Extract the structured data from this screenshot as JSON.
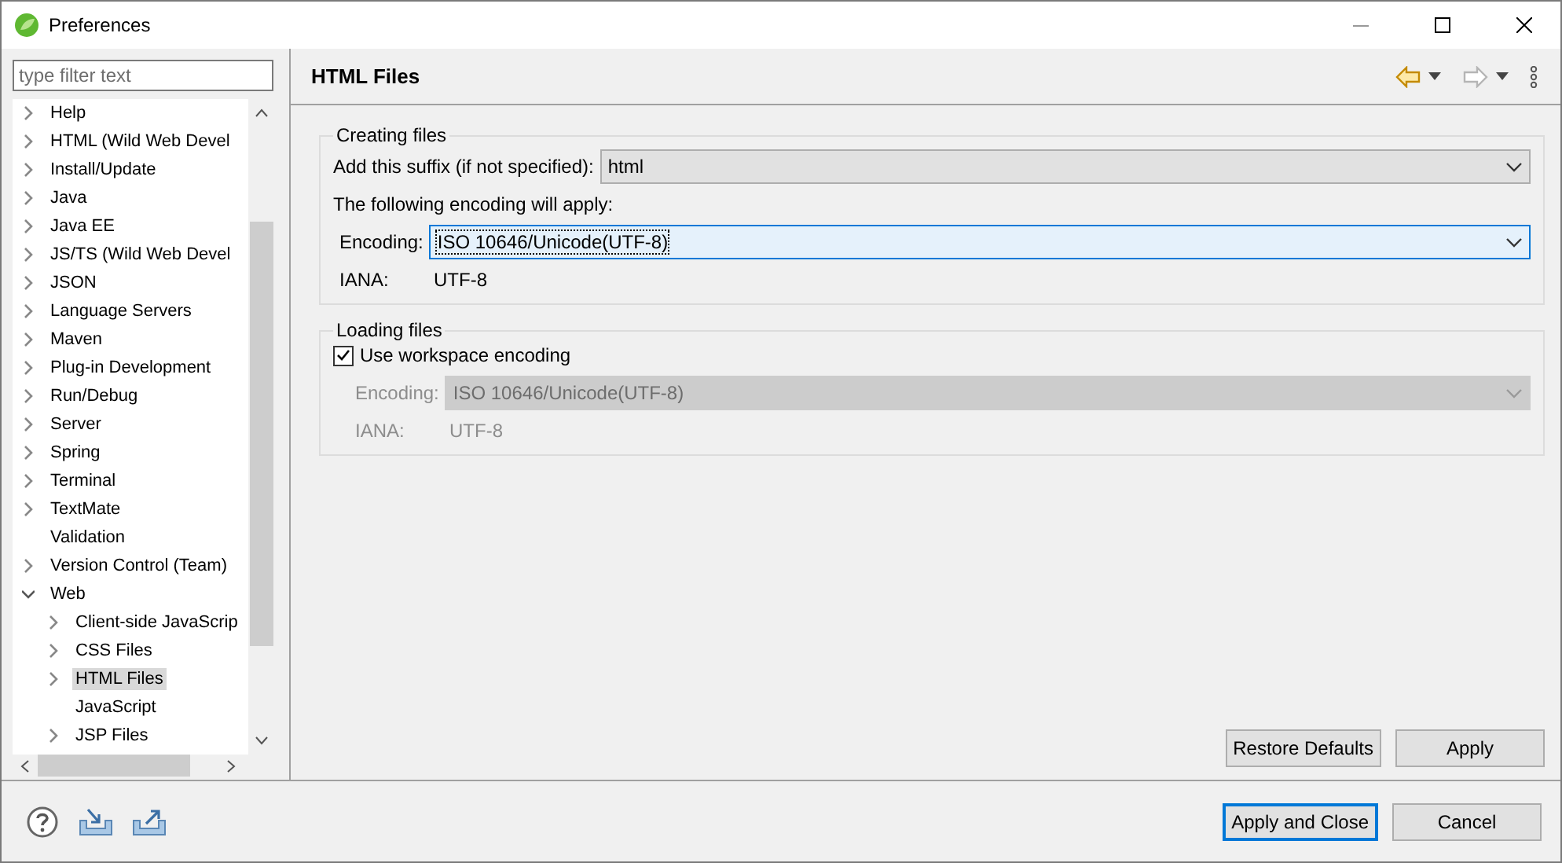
{
  "window": {
    "title": "Preferences"
  },
  "sidebar": {
    "filter": {
      "placeholder": "type filter text"
    },
    "tree": [
      {
        "label": "Help",
        "kind": "folder",
        "expanded": false,
        "selected": false
      },
      {
        "label": "HTML (Wild Web Devel",
        "kind": "folder",
        "expanded": false,
        "selected": false
      },
      {
        "label": "Install/Update",
        "kind": "folder",
        "expanded": false,
        "selected": false
      },
      {
        "label": "Java",
        "kind": "folder",
        "expanded": false,
        "selected": false
      },
      {
        "label": "Java EE",
        "kind": "folder",
        "expanded": false,
        "selected": false
      },
      {
        "label": "JS/TS (Wild Web Devel",
        "kind": "folder",
        "expanded": false,
        "selected": false
      },
      {
        "label": "JSON",
        "kind": "folder",
        "expanded": false,
        "selected": false
      },
      {
        "label": "Language Servers",
        "kind": "folder",
        "expanded": false,
        "selected": false
      },
      {
        "label": "Maven",
        "kind": "folder",
        "expanded": false,
        "selected": false
      },
      {
        "label": "Plug-in Development",
        "kind": "folder",
        "expanded": false,
        "selected": false
      },
      {
        "label": "Run/Debug",
        "kind": "folder",
        "expanded": false,
        "selected": false
      },
      {
        "label": "Server",
        "kind": "folder",
        "expanded": false,
        "selected": false
      },
      {
        "label": "Spring",
        "kind": "folder",
        "expanded": false,
        "selected": false
      },
      {
        "label": "Terminal",
        "kind": "folder",
        "expanded": false,
        "selected": false
      },
      {
        "label": "TextMate",
        "kind": "folder",
        "expanded": false,
        "selected": false
      },
      {
        "label": "Validation",
        "kind": "leaf",
        "selected": false
      },
      {
        "label": "Version Control (Team)",
        "kind": "folder",
        "expanded": false,
        "selected": false
      },
      {
        "label": "Web",
        "kind": "folder",
        "expanded": true,
        "selected": false,
        "children": [
          {
            "label": "Client-side JavaScrip",
            "kind": "folder",
            "expanded": false,
            "selected": false
          },
          {
            "label": "CSS Files",
            "kind": "folder",
            "expanded": false,
            "selected": false
          },
          {
            "label": "HTML Files",
            "kind": "folder",
            "expanded": false,
            "selected": true
          },
          {
            "label": "JavaScript",
            "kind": "leaf",
            "selected": false
          },
          {
            "label": "JSP Files",
            "kind": "folder",
            "expanded": false,
            "selected": false
          }
        ]
      }
    ]
  },
  "page": {
    "title": "HTML Files",
    "nav": {
      "back_enabled": true,
      "forward_enabled": false
    },
    "creating": {
      "title": "Creating files",
      "suffix_label": "Add this suffix (if not specified):",
      "suffix_value": "html",
      "note": "The following encoding will apply:",
      "encoding_label": "Encoding:",
      "encoding_value": "ISO 10646/Unicode(UTF-8)",
      "iana_label": "IANA:",
      "iana_value": "UTF-8"
    },
    "loading": {
      "title": "Loading files",
      "use_workspace": {
        "label": "Use workspace encoding",
        "checked": true
      },
      "encoding_label": "Encoding:",
      "encoding_value": "ISO 10646/Unicode(UTF-8)",
      "iana_label": "IANA:",
      "iana_value": "UTF-8"
    },
    "buttons": [
      "Restore Defaults",
      "Apply"
    ]
  },
  "dialog_buttons": [
    {
      "label": "Apply and Close",
      "default": true
    },
    {
      "label": "Cancel",
      "default": false
    }
  ]
}
